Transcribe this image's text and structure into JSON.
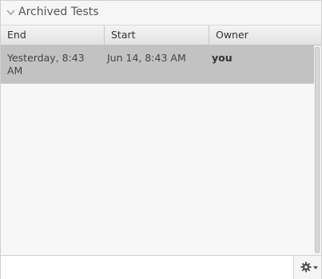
{
  "panel": {
    "title": "Archived Tests",
    "collapse_icon": "chevron-down-icon"
  },
  "table": {
    "columns": [
      "End",
      "Start",
      "Owner"
    ],
    "rows": [
      {
        "end": "Yesterday, 8:43 AM",
        "start": "Jun 14, 8:43 AM",
        "owner": "you",
        "selected": true
      }
    ]
  },
  "footer": {
    "settings_icon": "gear-icon",
    "dropdown_icon": "caret-down-icon"
  },
  "colors": {
    "selected_row": "#c2c2c2",
    "panel_background": "#f7f7f7",
    "border": "#cfcfcf"
  }
}
